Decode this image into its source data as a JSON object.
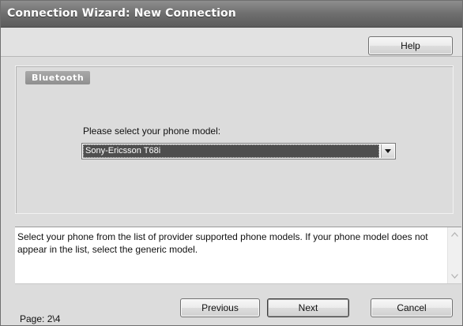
{
  "window": {
    "title": "Connection Wizard: New Connection"
  },
  "toolbar": {
    "help_label": "Help"
  },
  "section": {
    "tab_label": "Bluetooth"
  },
  "phone_select": {
    "label": "Please select your phone model:",
    "selected_value": "Sony-Ericsson T68i"
  },
  "description": {
    "text": "Select your phone from the list of provider supported phone models.  If your phone model does not appear in the list, select the generic model."
  },
  "footer": {
    "page_label": "Page:  2\\4",
    "previous_label": "Previous",
    "next_label": "Next",
    "cancel_label": "Cancel"
  },
  "icons": {
    "dropdown": "chevron-down-icon",
    "scroll_up": "arrow-up-icon",
    "scroll_down": "arrow-down-icon"
  },
  "colors": {
    "titlebar": "#6e6e6e",
    "window_bg": "#dcdcdc",
    "selection": "#4e4e4e"
  }
}
